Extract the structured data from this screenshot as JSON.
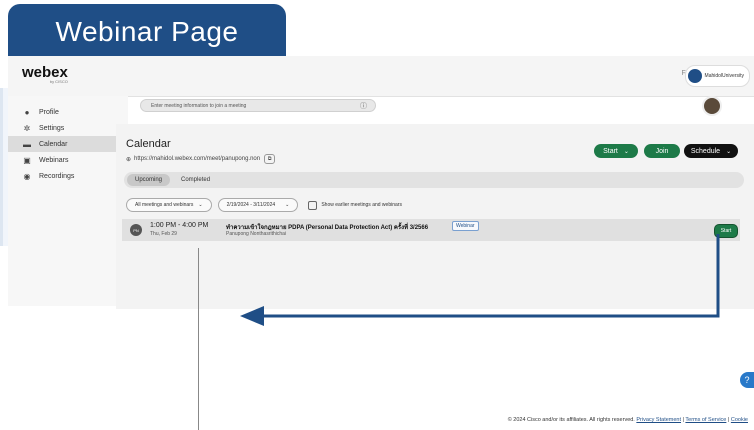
{
  "banner": {
    "title": "Webinar Page"
  },
  "header": {
    "logo": "webex",
    "logo_sub": "by CISCO",
    "for_label": "For",
    "org_name": "MahidolUniversity"
  },
  "join_box": {
    "placeholder": "Enter meeting information to join a meeting",
    "info_icon": "info-icon"
  },
  "sidebar": {
    "items": [
      {
        "label": "Profile",
        "icon": "profile-icon"
      },
      {
        "label": "Settings",
        "icon": "gear-icon"
      },
      {
        "label": "Calendar",
        "icon": "calendar-icon"
      },
      {
        "label": "Webinars",
        "icon": "webinar-icon"
      },
      {
        "label": "Recordings",
        "icon": "recording-icon"
      }
    ]
  },
  "calendar": {
    "title": "Calendar",
    "url": "https://mahidol.webex.com/meet/panupong.non",
    "buttons": {
      "start": "Start",
      "join": "Join",
      "schedule": "Schedule"
    },
    "tabs": [
      "Upcoming",
      "Completed"
    ],
    "filter_type": "All meetings and webinars",
    "date_range": "2/19/2024 - 3/11/2024",
    "show_earlier": "Show earlier meetings and webinars"
  },
  "meeting": {
    "initials": "PN",
    "time": "1:00 PM - 4:00 PM",
    "date": "Thu, Feb 29",
    "title": "ทำความเข้าใจกฎหมาย PDPA (Personal Data Protection Act) ครั้งที่ 3/2566",
    "host": "Panupong Nonthasrithichai",
    "badge": "Webinar",
    "start": "Start"
  },
  "footer": {
    "copyright": "© 2024 Cisco and/or its affiliates. All rights reserved.",
    "privacy": "Privacy Statement",
    "terms": "Terms of Service",
    "cookie": "Cookie"
  },
  "help": "?",
  "colors": {
    "accent": "#1f4e86",
    "green": "#1d7a48"
  }
}
